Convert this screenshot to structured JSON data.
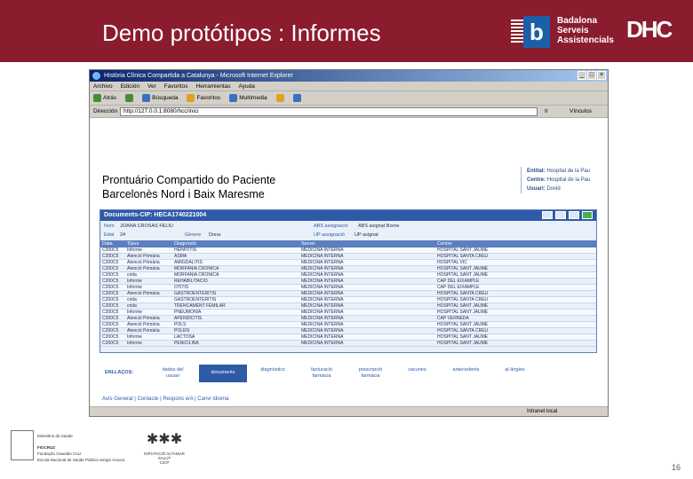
{
  "slide": {
    "title": "Demo protótipos : Informes",
    "logo_text": [
      "Badalona",
      "Serveis",
      "Assistencials"
    ],
    "logo_b": "b",
    "logo_dhc": "DHC",
    "page_number": "16"
  },
  "browser": {
    "window_title": "Història Clínica Compartida a Catalunya - Microsoft Internet Explorer",
    "menu": [
      "Archivo",
      "Edición",
      "Ver",
      "Favoritos",
      "Herramientas",
      "Ayuda"
    ],
    "toolbar": [
      "Atrás",
      "Búsqueda",
      "Favoritos",
      "Multimedia"
    ],
    "address_label": "Dirección",
    "address_value": "http://127.0.0.1:8080/hcc/inici",
    "go_label": "Ir",
    "links_label": "Vínculos",
    "status_zone": "Intranet local"
  },
  "page": {
    "title_line1": "Prontuário Compartido do Paciente",
    "title_line2": "Barcelonès Nord i Baix Maresme",
    "user_info": [
      {
        "label": "Entitat:",
        "value": "Hospital de la Pau"
      },
      {
        "label": "Centre:",
        "value": "Hospital de la Pau"
      },
      {
        "label": "Usuari:",
        "value": "Dovid"
      }
    ],
    "doc_header": "Documents-CIP: HECA1740221004",
    "patient": {
      "nom_label": "Nom",
      "nom_value": "JOANA CROSAS FELIU",
      "edat_label": "Edat",
      "edat_value": "24",
      "genere_label": "Gènere",
      "genere_value": "Dona",
      "abs_label": "ABS assignació",
      "abs_value": "ABS asignat Borne",
      "up_label": "UP assignació",
      "up_value": "UP asignat"
    },
    "columns": [
      "Data",
      "Tipus",
      "Diagnòstic",
      "Servei",
      "Centre"
    ],
    "rows": [
      [
        "C200C5",
        "Informe",
        "HEPATITIS",
        "MEDICINA INTERNA",
        "HOSPITAL SANT JAUME"
      ],
      [
        "C200C5",
        "Atenció Primària",
        "ASMA",
        "MEDICINA INTERNA",
        "HOSPITAL SANTA CREU"
      ],
      [
        "C200C5",
        "Atenció Primària",
        "AMIGDALITIS",
        "MEDICINA INTERNA",
        "HOSPITAL VIC"
      ],
      [
        "C200C5",
        "Atenció Primària",
        "MORFANIA CRÒNICA",
        "MEDICINA INTERNA",
        "HOSPITAL SANT JAUME"
      ],
      [
        "C200C5",
        "crida",
        "MORFANIA CRÒNICA",
        "MEDICINA INTERNA",
        "HOSPITAL SANT JAUME"
      ],
      [
        "C200C5",
        "Informe",
        "REHABILITACIÓ",
        "MEDICINA INTERNA",
        "CAP DEL EIXAMPLE"
      ],
      [
        "C200C5",
        "Informe",
        "OTITIS",
        "MEDICINA INTERNA",
        "CAP DEL EIXAMPLE"
      ],
      [
        "C200C5",
        "Atenció Primària",
        "GASTROENTERITIS",
        "MEDICINA INTERNA",
        "HOSPITAL SANTA CREU"
      ],
      [
        "C200C5",
        "crida",
        "GASTROENTERITIS",
        "MEDICINA INTERNA",
        "HOSPITAL SANTA CREU"
      ],
      [
        "C200C5",
        "crida",
        "TRENCAMENT FEMILAR",
        "MEDICINA INTERNA",
        "HOSPITAL SANT JAUME"
      ],
      [
        "C200C5",
        "Informe",
        "PNEUMÒNIA",
        "MEDICINA INTERNA",
        "HOSPITAL SANT JAUME"
      ],
      [
        "C200C5",
        "Atenció Primària",
        "APENDICITIS",
        "MEDICINA INTERNA",
        "CAP VERNEDA"
      ],
      [
        "C200C5",
        "Atenció Primària",
        "POLS",
        "MEDICINA INTERNA",
        "HOSPITAL SANT JAUME"
      ],
      [
        "C200C5",
        "Atenció Primària",
        "POLEN",
        "MEDICINA INTERNA",
        "HOSPITAL SANTA CREU"
      ],
      [
        "C200C5",
        "Informe",
        "LACTOSA",
        "MEDICINA INTERNA",
        "HOSPITAL SANT JAUME"
      ],
      [
        "C200C5",
        "Informe",
        "PENICILINA",
        "MEDICINA INTERNA",
        "HOSPITAL SANT JAUME"
      ]
    ],
    "tabs_label": "ENLLAÇOS:",
    "tabs": [
      "dades del\nusuari",
      "documents",
      "diagnòstics",
      "facturació\nfarmàcia",
      "prescripció\nfarmàcia",
      "vacunes",
      "antecedents",
      "al·lèrgies"
    ],
    "footer_links": "Avís General  |  Contacte  |  Respons e/A  |  Canvi Idioma"
  },
  "footer_logos": {
    "ministry": [
      "Ministério da Saúde",
      "FIOCRUZ",
      "Fundação Oswaldo Cruz",
      "Escola Nacional de Saúde Pública Sergio Arouca"
    ],
    "second": [
      "DIPUTACIÓ ALTAMAR",
      "SALUT",
      "CICP"
    ]
  }
}
